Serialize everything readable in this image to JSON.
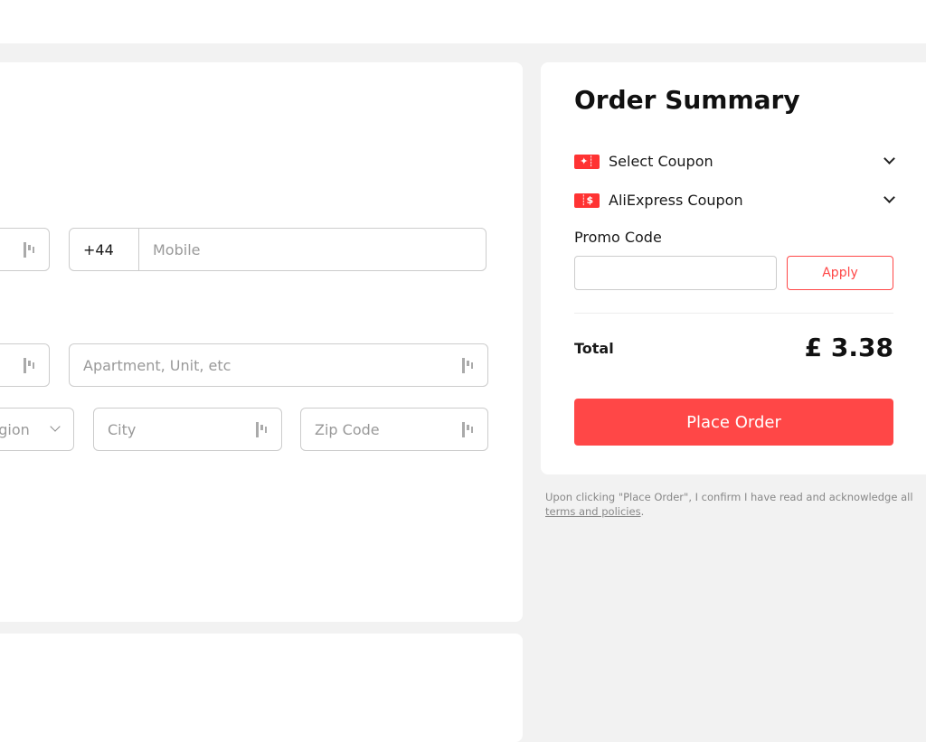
{
  "form": {
    "phone_prefix": "+44",
    "mobile_placeholder": "Mobile",
    "apartment_placeholder": "Apartment, Unit, etc",
    "region_placeholder": "Region",
    "city_placeholder": "City",
    "zip_placeholder": "Zip Code"
  },
  "summary": {
    "title": "Order Summary",
    "select_coupon": "Select Coupon",
    "aliexpress_coupon": "AliExpress Coupon",
    "promo_label": "Promo Code",
    "promo_value": "",
    "apply": "Apply",
    "total_label": "Total",
    "total_value": "£ 3.38",
    "place_order": "Place Order",
    "disclaimer": "Upon clicking \"Place Order\", I confirm I have read and acknowledge all",
    "terms_link": "terms and policies",
    "accent": "#ff4747"
  }
}
